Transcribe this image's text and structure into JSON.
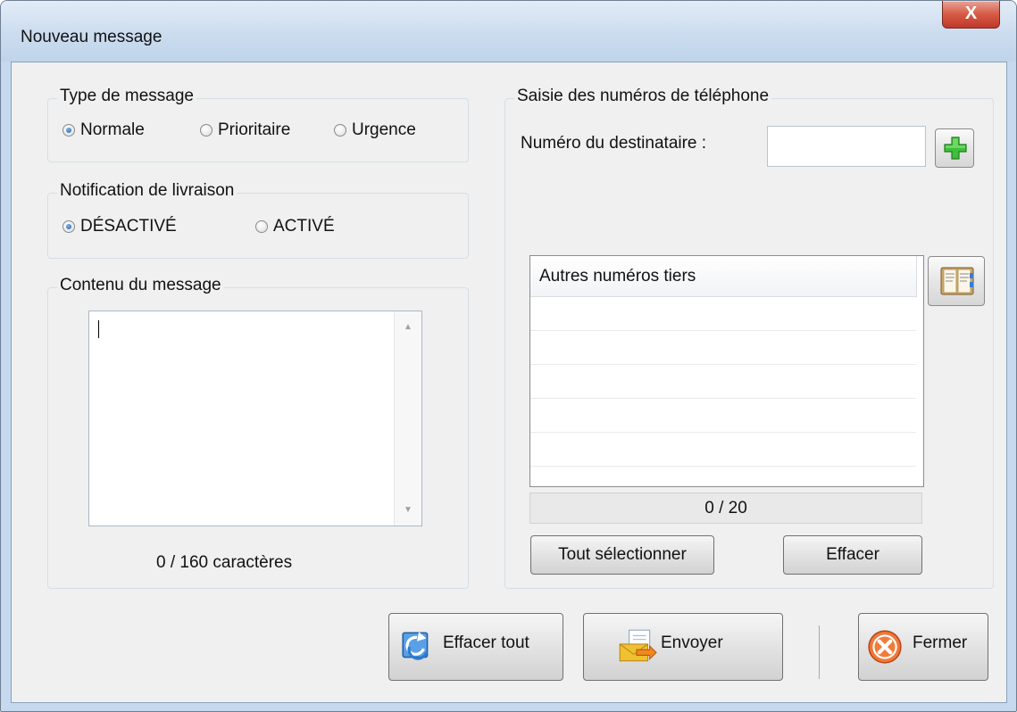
{
  "window": {
    "title": "Nouveau message",
    "close_label": "X"
  },
  "type_message": {
    "legend": "Type de message",
    "options": [
      {
        "label": "Normale",
        "selected": true
      },
      {
        "label": "Prioritaire",
        "selected": false
      },
      {
        "label": "Urgence",
        "selected": false
      }
    ]
  },
  "notification": {
    "legend": "Notification de livraison",
    "options": [
      {
        "label": "DÉSACTIVÉ",
        "selected": true
      },
      {
        "label": "ACTIVÉ",
        "selected": false
      }
    ]
  },
  "content": {
    "legend": "Contenu du message",
    "value": "",
    "counter": "0 / 160 caractères"
  },
  "phones": {
    "legend": "Saisie des numéros de téléphone",
    "recipient_label": "Numéro du destinataire :",
    "recipient_value": "",
    "add_icon": "green-plus-icon",
    "list_header": "Autres numéros tiers",
    "list_items": [],
    "address_book_icon": "address-book-icon",
    "count": "0 / 20",
    "select_all_label": "Tout sélectionner",
    "clear_label": "Effacer"
  },
  "footer": {
    "clear_all_label": "Effacer tout",
    "clear_all_icon": "refresh-icon",
    "send_label": "Envoyer",
    "send_icon": "send-mail-icon",
    "close_label": "Fermer",
    "close_icon": "orange-x-icon"
  }
}
